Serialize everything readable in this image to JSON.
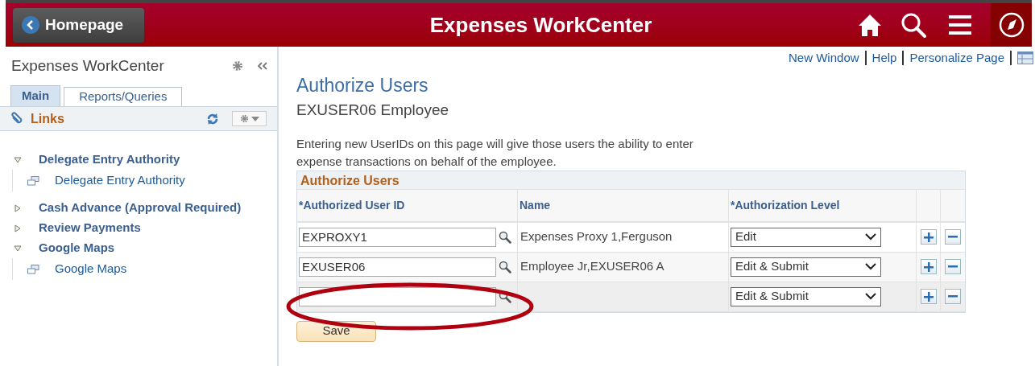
{
  "header": {
    "back_button": "Homepage",
    "title": "Expenses WorkCenter"
  },
  "sidebar": {
    "title": "Expenses WorkCenter",
    "tabs": [
      {
        "label": "Main",
        "selected": true
      },
      {
        "label": "Reports/Queries",
        "selected": false
      }
    ],
    "section": "Links",
    "items": [
      {
        "label": "Delegate Entry Authority",
        "expanded": true,
        "children": [
          {
            "label": "Delegate Entry Authority"
          }
        ]
      },
      {
        "label": "Cash Advance (Approval Required)",
        "expanded": false
      },
      {
        "label": "Review Payments",
        "expanded": false
      },
      {
        "label": "Google Maps",
        "expanded": true,
        "children": [
          {
            "label": "Google Maps"
          }
        ]
      }
    ]
  },
  "top_links": [
    "New Window",
    "Help",
    "Personalize Page"
  ],
  "page": {
    "title": "Authorize Users",
    "subtitle": "EXUSER06 Employee",
    "description": "Entering new UserIDs on this page will give those users the ability to enter expense transactions on behalf of the employee."
  },
  "grid": {
    "title": "Authorize Users",
    "columns": [
      "*Authorized User ID",
      "Name",
      "*Authorization Level"
    ],
    "rows": [
      {
        "user_id": "EXPROXY1",
        "name": "Expenses Proxy 1,Ferguson",
        "level": "Edit"
      },
      {
        "user_id": "EXUSER06",
        "name": "Employee Jr,EXUSER06 A",
        "level": "Edit & Submit"
      },
      {
        "user_id": "",
        "name": "",
        "level": "Edit & Submit"
      }
    ]
  },
  "save_button": "Save"
}
